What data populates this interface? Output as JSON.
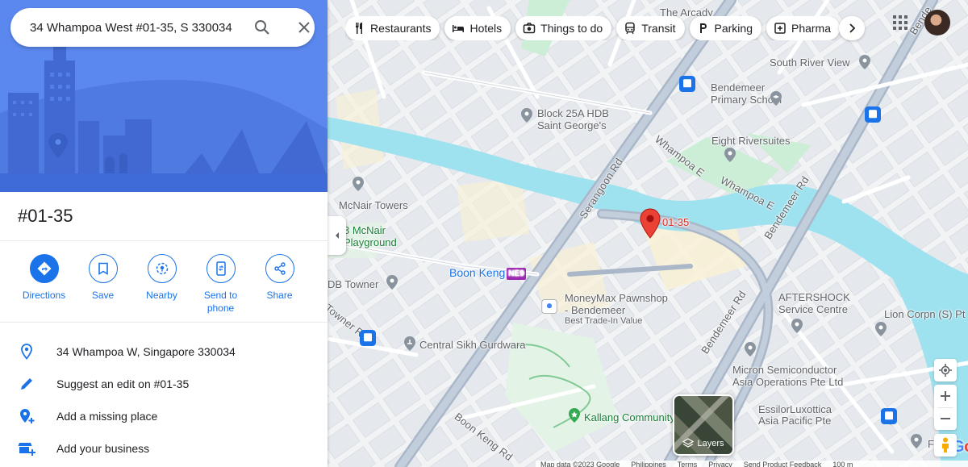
{
  "search": {
    "query": "34 Whampoa West #01-35, S 330034"
  },
  "place": {
    "title": "#01-35",
    "actions": [
      {
        "label": "Directions"
      },
      {
        "label": "Save"
      },
      {
        "label": "Nearby"
      },
      {
        "label": "Send to phone"
      },
      {
        "label": "Share"
      }
    ],
    "info_rows": [
      {
        "text": "34 Whampoa W, Singapore 330034",
        "icon": "location-pin-icon"
      },
      {
        "text": "Suggest an edit on #01-35",
        "icon": "pencil-icon"
      },
      {
        "text": "Add a missing place",
        "icon": "add-location-icon"
      },
      {
        "text": "Add your business",
        "icon": "add-business-icon"
      }
    ]
  },
  "chips": [
    {
      "label": "Restaurants",
      "icon": "restaurant-icon"
    },
    {
      "label": "Hotels",
      "icon": "hotel-icon"
    },
    {
      "label": "Things to do",
      "icon": "camera-icon"
    },
    {
      "label": "Transit",
      "icon": "transit-icon"
    },
    {
      "label": "Parking",
      "icon": "parking-icon"
    },
    {
      "label": "Pharma",
      "icon": "pharmacy-icon"
    }
  ],
  "map": {
    "pin_label": "01-35",
    "labels": {
      "the_arcady": "The Arcady",
      "south_river_view": "South River View",
      "bendemeer_primary_1": "Bendemeer",
      "bendemeer_primary_2": "Primary School",
      "block25a_1": "Block 25A HDB",
      "block25a_2": "Saint George's",
      "eight_riversuites": "Eight Riversuites",
      "mcnair_towers": "McNair Towers",
      "mcnair_playground_1": "8 McNair",
      "mcnair_playground_2": "Playground",
      "boon_keng": "Boon Keng",
      "boon_keng_code": "NE9",
      "db_towner": "DB Towner",
      "moneymax_1": "MoneyMax Pawnshop",
      "moneymax_2": "- Bendemeer",
      "moneymax_3": "Best Trade-In Value",
      "aftershock_1": "AFTERSHOCK",
      "aftershock_2": "Service Centre",
      "lion_corpn": "Lion Corpn (S) Pt",
      "central_sikh": "Central Sikh Gurdwara",
      "micron_1": "Micron Semiconductor",
      "micron_2": "Asia Operations Pte Ltd",
      "kallang_cc": "Kallang Community Club",
      "essilor_1": "EssilorLuxottica",
      "essilor_2": "Asia Pacific Pte",
      "fle": "Fle",
      "serangoon_rd": "Serangoon Rd",
      "whampoa_e": "Whampoa E",
      "whampoa_e2": "Whampoa E",
      "bendemeer_rd_1": "Bendemeer Rd",
      "bendemeer_rd_2": "Bendemeer Rd",
      "boon_keng_rd": "Boon Keng Rd",
      "towner_rd": "Towner Rd",
      "bendemeer_top": "Bende"
    },
    "layers_label": "Layers",
    "google_logo": "Google",
    "attribution": [
      "Map data ©2023 Google",
      "Philippines",
      "Terms",
      "Privacy",
      "Send Product Feedback",
      "100 m"
    ]
  }
}
